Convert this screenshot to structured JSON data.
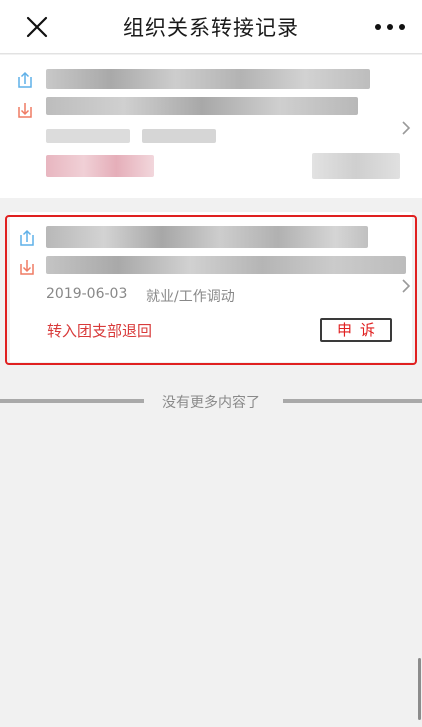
{
  "header": {
    "title": "组织关系转接记录",
    "close_icon": "close-icon",
    "more_icon": "more-icon"
  },
  "records": [
    {
      "out_icon": "transfer-out-icon",
      "in_icon": "transfer-in-icon",
      "chevron_icon": "chevron-right-icon"
    },
    {
      "out_icon": "transfer-out-icon",
      "in_icon": "transfer-in-icon",
      "chevron_icon": "chevron-right-icon",
      "date": "2019-06-03",
      "type": "就业/工作调动",
      "status": "转入团支部退回",
      "appeal_label": "申诉"
    }
  ],
  "footer": {
    "no_more": "没有更多内容了"
  },
  "colors": {
    "accent_red": "#e02020",
    "out_icon": "#5fb0e8",
    "in_icon": "#ef7b63"
  }
}
